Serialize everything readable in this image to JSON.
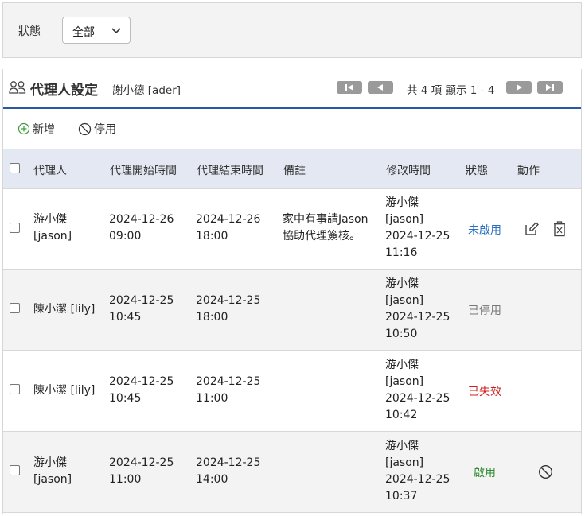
{
  "filter": {
    "label": "狀態",
    "select_value": "全部"
  },
  "header": {
    "title": "代理人設定",
    "user": "謝小德 [ader]",
    "pager_text": "共 4 項 顯示 1 - 4"
  },
  "toolbar": {
    "add_label": "新增",
    "disable_label": "停用"
  },
  "table": {
    "columns": [
      "代理人",
      "代理開始時間",
      "代理結束時間",
      "備註",
      "修改時間",
      "狀態",
      "動作"
    ],
    "rows": [
      {
        "agent": [
          "游小傑",
          "[jason]"
        ],
        "start": [
          "2024-12-26",
          "09:00"
        ],
        "end": [
          "2024-12-26",
          "18:00"
        ],
        "note": [
          "家中有事請Jason",
          "協助代理簽核。"
        ],
        "modified": [
          "游小傑",
          "[jason]",
          "2024-12-25",
          "11:16"
        ],
        "status": "未啟用",
        "status_color": "#2a6fc0",
        "actions": [
          "edit-icon",
          "delete-icon"
        ]
      },
      {
        "agent": [
          "陳小潔 [lily]"
        ],
        "start": [
          "2024-12-25",
          "10:45"
        ],
        "end": [
          "2024-12-25",
          "18:00"
        ],
        "note": [],
        "modified": [
          "游小傑",
          "[jason]",
          "2024-12-25",
          "10:50"
        ],
        "status": "已停用",
        "status_color": "#777777",
        "actions": []
      },
      {
        "agent": [
          "陳小潔 [lily]"
        ],
        "start": [
          "2024-12-25",
          "10:45"
        ],
        "end": [
          "2024-12-25",
          "11:00"
        ],
        "note": [],
        "modified": [
          "游小傑",
          "[jason]",
          "2024-12-25",
          "10:42"
        ],
        "status": "已失效",
        "status_color": "#d02020",
        "actions": []
      },
      {
        "agent": [
          "游小傑",
          "[jason]"
        ],
        "start": [
          "2024-12-25",
          "11:00"
        ],
        "end": [
          "2024-12-25",
          "14:00"
        ],
        "note": [],
        "modified": [
          "游小傑",
          "[jason]",
          "2024-12-25",
          "10:37"
        ],
        "status": "啟用",
        "status_color": "#2e8b2e",
        "actions": [
          "disable-icon"
        ]
      }
    ]
  }
}
